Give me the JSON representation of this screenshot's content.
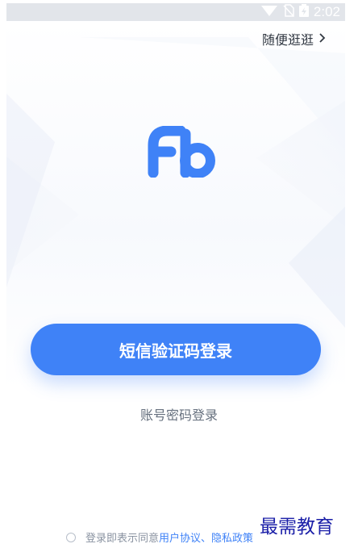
{
  "status_bar": {
    "time": "2:02",
    "icons": [
      "wifi-icon",
      "no-sim-icon",
      "battery-charging-icon"
    ]
  },
  "header": {
    "browse_label": "随便逛逛",
    "browse_icon": "chevron-right-icon"
  },
  "logo": {
    "icon": "fb-logo-icon",
    "text": "Fb"
  },
  "login": {
    "sms_button_label": "短信验证码登录",
    "password_login_label": "账号密码登录"
  },
  "agreement": {
    "prefix": "登录即表示同意",
    "user_agreement": "用户协议",
    "separator": "、",
    "privacy_policy": "隐私政策"
  },
  "watermark": {
    "text": "最需教育"
  },
  "colors": {
    "primary": "#3f82f7",
    "text_dark": "#333a44",
    "text_muted": "#66707e",
    "watermark": "#1b1fa8"
  }
}
